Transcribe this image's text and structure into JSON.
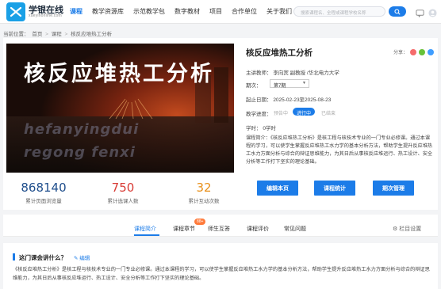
{
  "brand": {
    "name": "学银在线",
    "sub": "xueyinonline.com"
  },
  "nav": [
    "课程",
    "教学资源库",
    "示范教学包",
    "数字教材",
    "项目",
    "合作单位",
    "关于我们"
  ],
  "search": {
    "placeholder": "搜索课程名、全程或课程学校名称"
  },
  "breadcrumb": [
    "当前位置：",
    "首页",
    ">",
    "课程",
    ">",
    "核反应堆热工分析"
  ],
  "cover": {
    "title": "核反应堆热工分析",
    "watermark1": "hefanyingdui",
    "watermark2": "regong fenxi"
  },
  "course": {
    "title": "核反应堆热工分析",
    "share_label": "分享：",
    "teacher_label": "主讲教师：",
    "teacher": "李向宾 副教授 /华北电力大学",
    "period_label": "期次：",
    "period": "第7期",
    "dates_label": "起止日期：",
    "dates": "2025-02-23至2025-08-23",
    "status_label": "教学进度：",
    "status": [
      "预告中",
      "进行中",
      "已结束"
    ],
    "credit_label": "学时：",
    "credit": "0学时",
    "desc_label": "课程简介：",
    "desc": "《核反应堆热工分析》是核工程与核技术专业的一门专业必修课。通过本课程的学习，可以使学生掌握反应堆热工水力学的基本分析方法，帮助学生提升反应堆热工水力方面分析与综合的辩证思维能力，为其日后从事核反应堆运行、热工设计、安全分析等工作打下坚实的理论基础。"
  },
  "stats": [
    {
      "value": "868140",
      "label": "累计页面浏览量",
      "color": "#1f4e8c"
    },
    {
      "value": "750",
      "label": "累计选课人数",
      "color": "#d83a34"
    },
    {
      "value": "32",
      "label": "累计互动次数",
      "color": "#e8901a"
    }
  ],
  "actions": [
    "编辑本页",
    "课程统计",
    "期次管理"
  ],
  "tabs": [
    "课程简介",
    "课程章节",
    "师生互答",
    "课程评价",
    "常见问题"
  ],
  "tab_badge": "88+",
  "settings_label": "栏目设置",
  "section": {
    "title": "这门课会讲什么？",
    "edit": "编辑",
    "text": "《核反应堆热工分析》是核工程与核技术专业的一门专业必修课。通过本课程的学习，可以使学生掌握反应堆热工水力学的基本分析方法，帮助学生提升反应堆热工水力方面分析与综合的辩证思维能力，为其日后从事核反应堆运行、热工设计、安全分析等工作打下坚实的理论基础。"
  },
  "colors": {
    "accent": "#1c7ce8",
    "badge": "#ff7a3a"
  }
}
